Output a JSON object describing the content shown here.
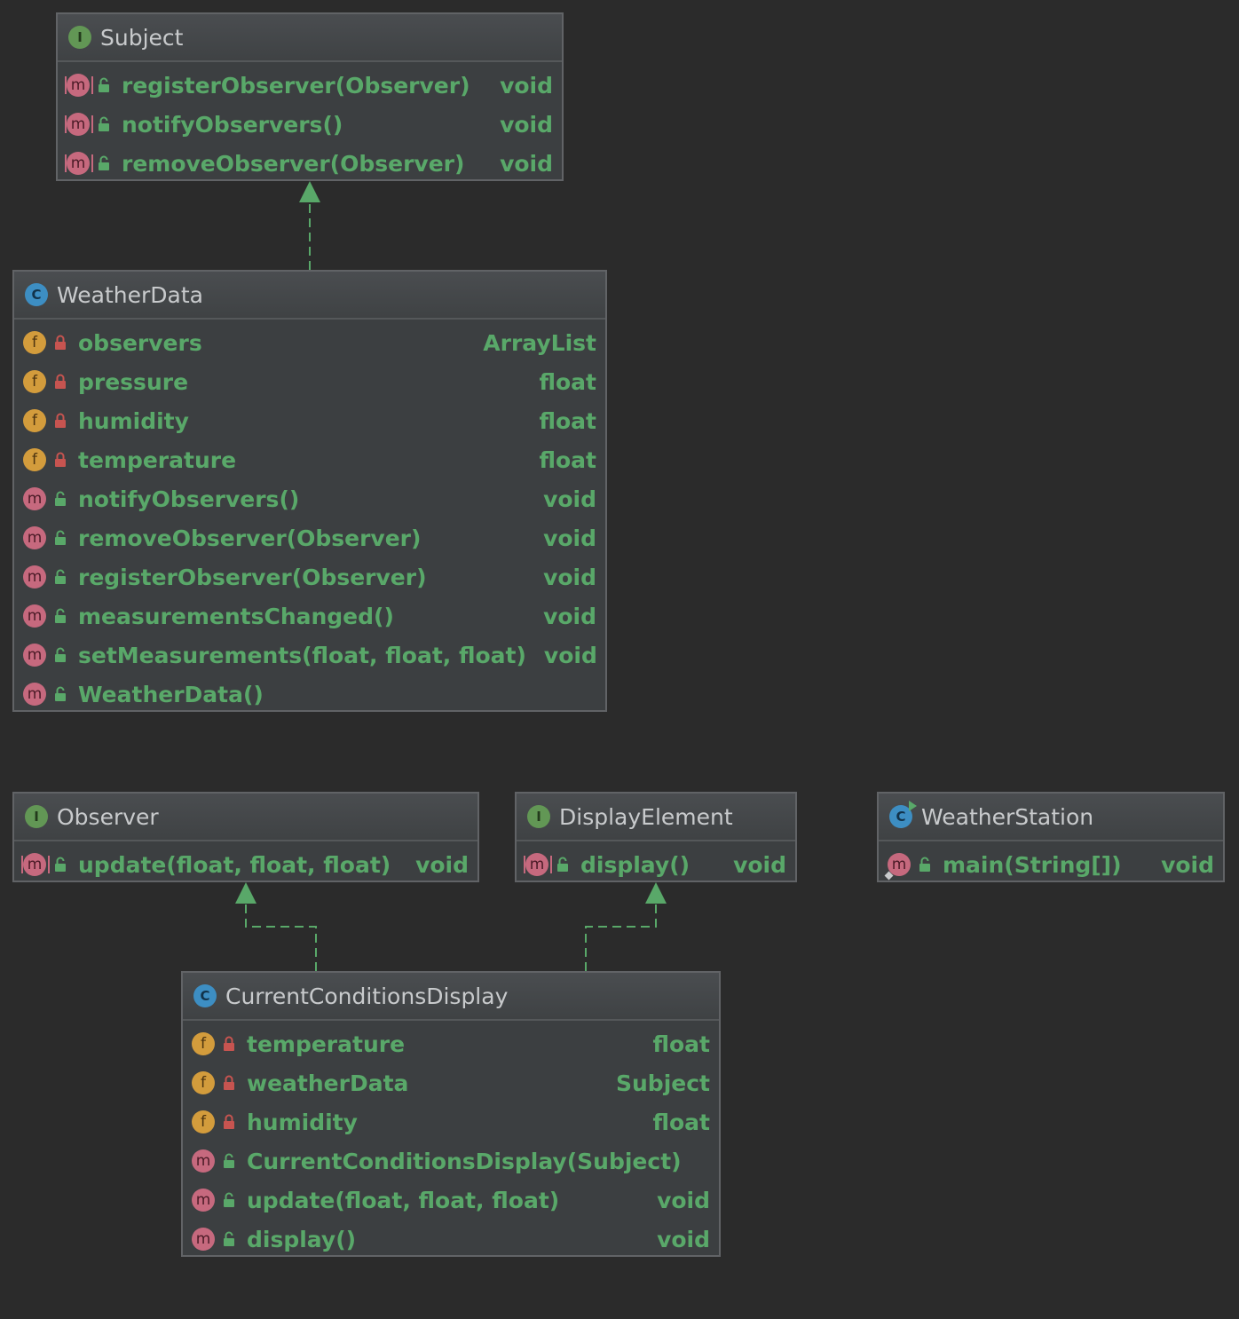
{
  "nodes": {
    "subject": {
      "title": "Subject",
      "kind": "interface",
      "kind_letter": "I",
      "members": [
        {
          "name": "registerObserver(Observer)",
          "type": "void",
          "marker": "m",
          "visibility": "public",
          "abstract": true
        },
        {
          "name": "notifyObservers()",
          "type": "void",
          "marker": "m",
          "visibility": "public",
          "abstract": true
        },
        {
          "name": "removeObserver(Observer)",
          "type": "void",
          "marker": "m",
          "visibility": "public",
          "abstract": true
        }
      ]
    },
    "weatherdata": {
      "title": "WeatherData",
      "kind": "class",
      "kind_letter": "C",
      "members": [
        {
          "name": "observers",
          "type": "ArrayList",
          "marker": "f",
          "visibility": "private"
        },
        {
          "name": "pressure",
          "type": "float",
          "marker": "f",
          "visibility": "private"
        },
        {
          "name": "humidity",
          "type": "float",
          "marker": "f",
          "visibility": "private"
        },
        {
          "name": "temperature",
          "type": "float",
          "marker": "f",
          "visibility": "private"
        },
        {
          "name": "notifyObservers()",
          "type": "void",
          "marker": "m",
          "visibility": "public"
        },
        {
          "name": "removeObserver(Observer)",
          "type": "void",
          "marker": "m",
          "visibility": "public"
        },
        {
          "name": "registerObserver(Observer)",
          "type": "void",
          "marker": "m",
          "visibility": "public"
        },
        {
          "name": "measurementsChanged()",
          "type": "void",
          "marker": "m",
          "visibility": "public"
        },
        {
          "name": "setMeasurements(float, float, float)",
          "type": "void",
          "marker": "m",
          "visibility": "public"
        },
        {
          "name": "WeatherData()",
          "type": "",
          "marker": "m",
          "visibility": "public"
        }
      ]
    },
    "observer": {
      "title": "Observer",
      "kind": "interface",
      "kind_letter": "I",
      "members": [
        {
          "name": "update(float, float, float)",
          "type": "void",
          "marker": "m",
          "visibility": "public",
          "abstract": true
        }
      ]
    },
    "displayelement": {
      "title": "DisplayElement",
      "kind": "interface",
      "kind_letter": "I",
      "members": [
        {
          "name": "display()",
          "type": "void",
          "marker": "m",
          "visibility": "public",
          "abstract": true
        }
      ]
    },
    "weatherstation": {
      "title": "WeatherStation",
      "kind": "class",
      "kind_letter": "C",
      "runnable": true,
      "members": [
        {
          "name": "main(String[])",
          "type": "void",
          "marker": "m",
          "visibility": "public",
          "static": true
        }
      ]
    },
    "currentconditionsdisplay": {
      "title": "CurrentConditionsDisplay",
      "kind": "class",
      "kind_letter": "C",
      "members": [
        {
          "name": "temperature",
          "type": "float",
          "marker": "f",
          "visibility": "private"
        },
        {
          "name": "weatherData",
          "type": "Subject",
          "marker": "f",
          "visibility": "private"
        },
        {
          "name": "humidity",
          "type": "float",
          "marker": "f",
          "visibility": "private"
        },
        {
          "name": "CurrentConditionsDisplay(Subject)",
          "type": "",
          "marker": "m",
          "visibility": "public"
        },
        {
          "name": "update(float, float, float)",
          "type": "void",
          "marker": "m",
          "visibility": "public"
        },
        {
          "name": "display()",
          "type": "void",
          "marker": "m",
          "visibility": "public"
        }
      ]
    }
  },
  "edges": [
    {
      "from": "WeatherData",
      "to": "Subject",
      "kind": "implements"
    },
    {
      "from": "CurrentConditionsDisplay",
      "to": "Observer",
      "kind": "implements"
    },
    {
      "from": "CurrentConditionsDisplay",
      "to": "DisplayElement",
      "kind": "implements"
    }
  ],
  "colors": {
    "background": "#2b2b2b",
    "node_bg": "#3c3f41",
    "member_text": "#59a869",
    "edge": "#59a869",
    "method_marker": "#c6697e",
    "field_marker": "#d39c3c",
    "interface_marker": "#629755",
    "class_marker": "#3d8ec3"
  }
}
